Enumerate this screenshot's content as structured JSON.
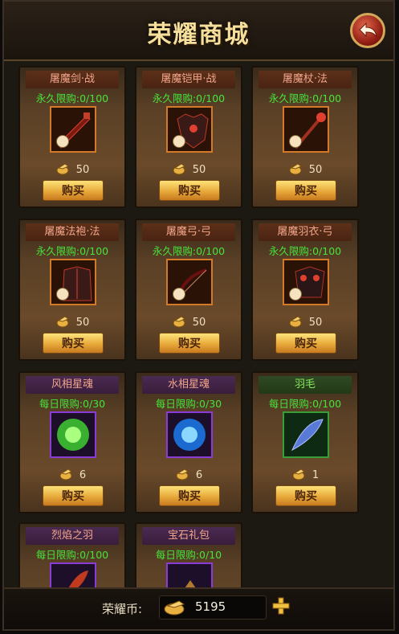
{
  "header": {
    "title": "荣耀商城"
  },
  "buy_label": "购买",
  "items": [
    {
      "name": "屠魔剑·战",
      "limit": "永久限购:0/100",
      "price": "50",
      "icon": "sword-icon",
      "rarity": "orange"
    },
    {
      "name": "屠魔铠甲·战",
      "limit": "永久限购:0/100",
      "price": "50",
      "icon": "armor-icon",
      "rarity": "orange"
    },
    {
      "name": "屠魔杖·法",
      "limit": "永久限购:0/100",
      "price": "50",
      "icon": "staff-icon",
      "rarity": "orange"
    },
    {
      "name": "屠魔法袍·法",
      "limit": "永久限购:0/100",
      "price": "50",
      "icon": "robe-icon",
      "rarity": "orange"
    },
    {
      "name": "屠魔弓·弓",
      "limit": "永久限购:0/100",
      "price": "50",
      "icon": "bow-icon",
      "rarity": "orange"
    },
    {
      "name": "屠魔羽衣·弓",
      "limit": "永久限购:0/100",
      "price": "50",
      "icon": "feather-armor-icon",
      "rarity": "orange"
    },
    {
      "name": "风相星魂",
      "limit": "每日限购:0/30",
      "price": "6",
      "icon": "wind-orb-icon",
      "rarity": "purple"
    },
    {
      "name": "水相星魂",
      "limit": "每日限购:0/30",
      "price": "6",
      "icon": "water-orb-icon",
      "rarity": "purple"
    },
    {
      "name": "羽毛",
      "limit": "每日限购:0/100",
      "price": "1",
      "icon": "feather-icon",
      "rarity": "green"
    },
    {
      "name": "烈焰之羽",
      "limit": "每日限购:0/100",
      "price": "",
      "icon": "flame-feather-icon",
      "rarity": "purple"
    },
    {
      "name": "宝石礼包",
      "limit": "每日限购:0/10",
      "price": "",
      "icon": "gem-pack-icon",
      "rarity": "purple"
    }
  ],
  "footer": {
    "currency_label": "荣耀币:",
    "currency_value": "5195"
  },
  "colors": {
    "limit_green": "#46e43a",
    "title_gold": "#f6df9a",
    "button_gold": "#e8a93a"
  }
}
